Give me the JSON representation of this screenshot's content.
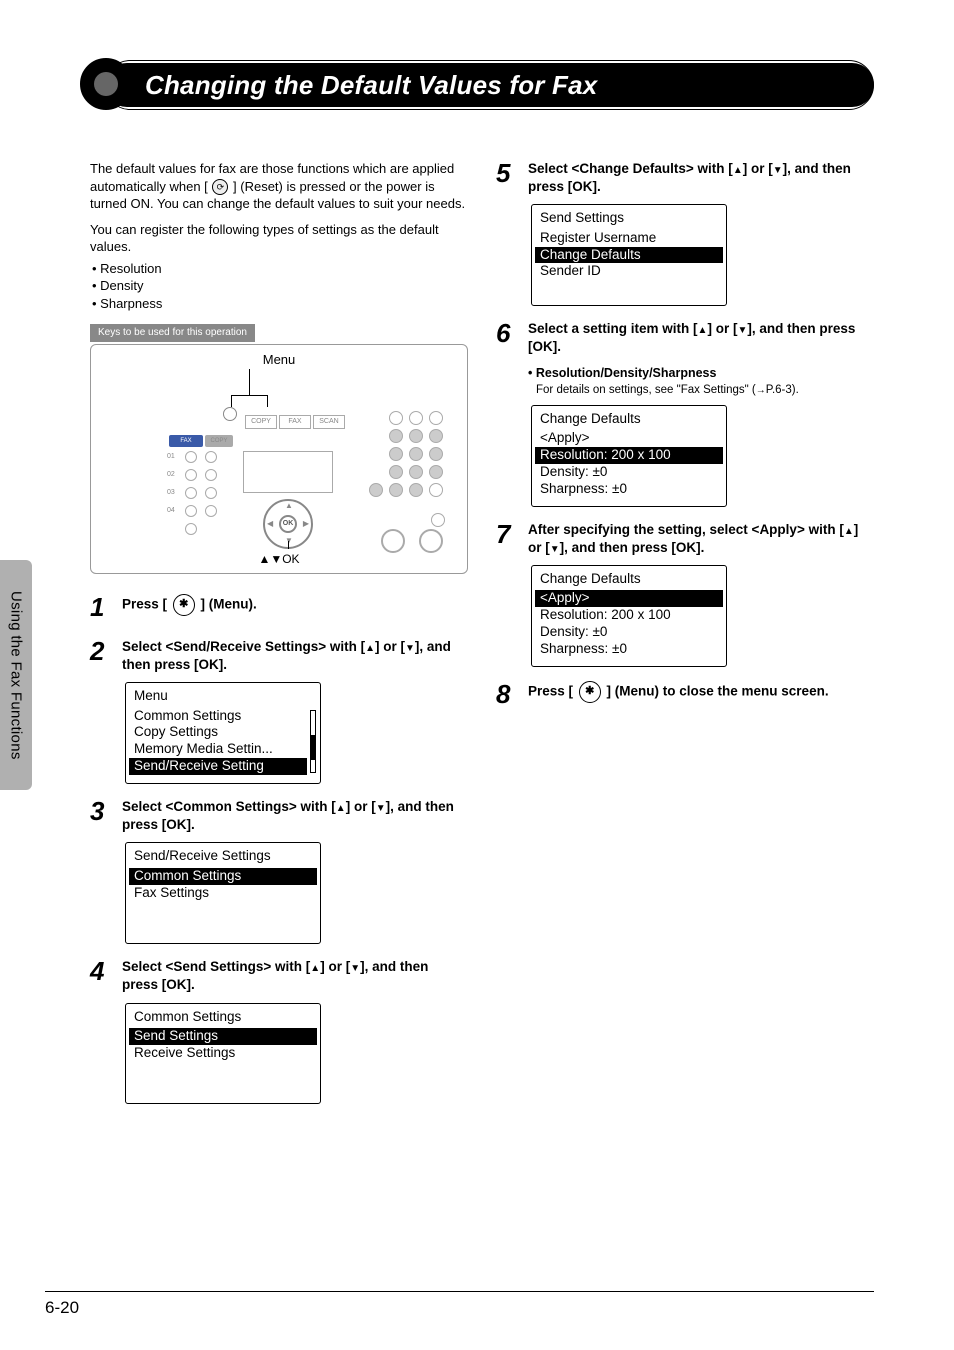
{
  "sideTab": "Using the Fax Functions",
  "title": "Changing the Default Values for Fax",
  "intro1": "The default values for fax are those functions which are applied automatically when [ ⟳ ] (Reset) is pressed or the power is turned ON. You can change the default values to suit your needs.",
  "intro2": "You can register the following types of settings as the default values.",
  "bullets": [
    "Resolution",
    "Density",
    "Sharpness"
  ],
  "keysLabel": "Keys to be used for this operation",
  "diagram": {
    "menuLabel": "Menu",
    "modeButtons": [
      "COPY",
      "FAX",
      "SCAN"
    ],
    "faxTab": "FAX",
    "copyTab": "COPY",
    "arrowOk": "▲▼OK"
  },
  "steps": {
    "s1": {
      "text": "Press [  ",
      "suffix": " ] (Menu)."
    },
    "s2": {
      "prefix": "Select <Send/Receive Settings> with [",
      "mid": "] or [",
      "suffix": "], and then press [OK].",
      "lcd": {
        "title": "Menu",
        "rows": [
          "Common Settings",
          "Copy Settings",
          "Memory Media Settin..."
        ],
        "sel": "Send/Receive Setting",
        "selPos": "bottom",
        "scrollbar": true
      }
    },
    "s3": {
      "prefix": "Select <Common Settings> with [",
      "mid": "] or [",
      "suffix": "], and then press [OK].",
      "lcd": {
        "title": "Send/Receive Settings",
        "rows": [
          "Fax Settings"
        ],
        "sel": "Common Settings",
        "selPos": "top"
      }
    },
    "s4": {
      "prefix": "Select <Send Settings> with [",
      "mid": "] or [",
      "suffix": "], and then press [OK].",
      "lcd": {
        "title": "Common Settings",
        "rows": [
          "Receive Settings"
        ],
        "sel": "Send Settings",
        "selPos": "top"
      }
    },
    "s5": {
      "prefix": "Select <Change Defaults> with [",
      "mid": "] or [",
      "suffix": "], and then press [OK].",
      "lcd": {
        "title": "Send Settings",
        "rows": [
          "Register Username"
        ],
        "sel": "Change Defaults",
        "selPos": "middle",
        "extra": "Sender ID"
      }
    },
    "s6": {
      "prefix": "Select a setting item with [",
      "mid": "] or [",
      "suffix": "], and then press [OK].",
      "subBullet": "Resolution/Density/Sharpness",
      "subDetailPrefix": "For details on settings, see \"Fax Settings\" (",
      "subDetailXref": "P.6-3",
      "subDetailSuffix": ").",
      "lcd": {
        "title": "Change Defaults",
        "rows": [
          "<Apply>"
        ],
        "sel": "Resolution: 200 x 100",
        "selPos": "middle",
        "extra": "Density: ±0",
        "extra2": "Sharpness: ±0"
      }
    },
    "s7": {
      "prefix": "After specifying the setting, select <Apply> with [",
      "mid": "] or [",
      "suffix": "], and then press [OK].",
      "lcd": {
        "title": "Change Defaults",
        "sel": "<Apply>",
        "selPos": "top",
        "rows": [
          "Resolution: 200 x 100",
          "Density: ±0",
          "Sharpness: ±0"
        ]
      }
    },
    "s8": {
      "prefix": "Press [  ",
      "suffix": " ] (Menu) to close the menu screen."
    }
  },
  "pageNumber": "6-20"
}
